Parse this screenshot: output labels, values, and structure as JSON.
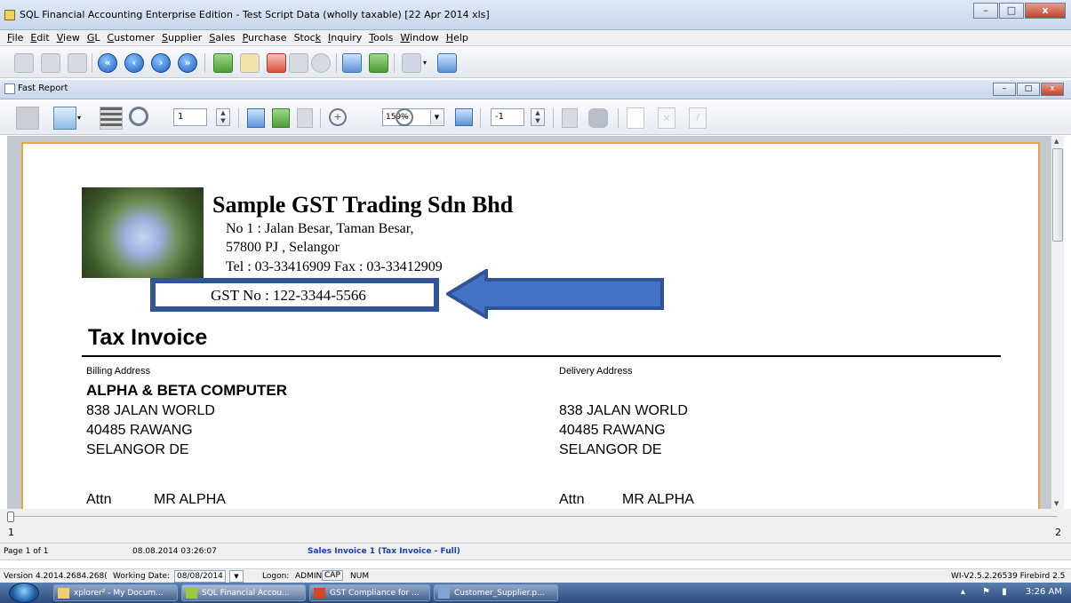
{
  "window": {
    "title": "SQL Financial Accounting Enterprise Edition - Test Script Data (wholly taxable) [22 Apr 2014 xls]"
  },
  "menu": [
    {
      "pre": "",
      "u": "F",
      "post": "ile"
    },
    {
      "pre": "",
      "u": "E",
      "post": "dit"
    },
    {
      "pre": "",
      "u": "V",
      "post": "iew"
    },
    {
      "pre": "",
      "u": "G",
      "post": "L"
    },
    {
      "pre": "",
      "u": "C",
      "post": "ustomer"
    },
    {
      "pre": "",
      "u": "S",
      "post": "upplier"
    },
    {
      "pre": "",
      "u": "S",
      "post": "ales"
    },
    {
      "pre": "",
      "u": "P",
      "post": "urchase"
    },
    {
      "pre": "Stoc",
      "u": "k",
      "post": ""
    },
    {
      "pre": "",
      "u": "I",
      "post": "nquiry"
    },
    {
      "pre": "",
      "u": "T",
      "post": "ools"
    },
    {
      "pre": "",
      "u": "W",
      "post": "indow"
    },
    {
      "pre": "",
      "u": "H",
      "post": "elp"
    }
  ],
  "report": {
    "window_title": "Fast Report",
    "page_input": "1",
    "zoom": "159%",
    "find_input": "-1"
  },
  "invoice": {
    "company_name": "Sample GST Trading Sdn Bhd",
    "address1": "No 1 : Jalan Besar, Taman Besar,",
    "address2": "57800 PJ , Selangor",
    "phone": "Tel : 03-33416909  Fax : 03-33412909",
    "gst_no": "GST No : 122-3344-5566",
    "doc_title": "Tax Invoice",
    "billing_label": "Billing Address",
    "delivery_label": "Delivery Address",
    "customer_name": "ALPHA & BETA COMPUTER",
    "billing": {
      "line1": "838 JALAN WORLD",
      "line2": "40485 RAWANG",
      "line3": "SELANGOR DE",
      "attn_label": "Attn",
      "attn": "MR ALPHA"
    },
    "delivery": {
      "line1": "838 JALAN WORLD",
      "line2": "40485 RAWANG",
      "line3": "SELANGOR DE",
      "attn_label": "Attn",
      "attn": "MR ALPHA"
    }
  },
  "slider": {
    "min": "1",
    "max": "2"
  },
  "status": {
    "page": "Page 1 of 1",
    "datetime": "08.08.2014 03:26:07",
    "report_name": "Sales Invoice 1 (Tax Invoice - Full)"
  },
  "appstatus": {
    "version": "Version 4.2014.2684.268(",
    "working_date_label": "Working Date:",
    "working_date": "08/08/2014",
    "logon_label": "Logon:",
    "user": "ADMIN",
    "cap": "CAP",
    "num": "NUM",
    "right": "WI-V2.5.2.26539 Firebird 2.5"
  },
  "taskbar": {
    "items": [
      "xplorer² - My Docum...",
      "SQL Financial Accou...",
      "GST Compliance for ...",
      "Customer_Supplier.p..."
    ],
    "time": "3:26 AM"
  },
  "colors": {
    "highlight": "#2f5597",
    "frame": "#e5a93c",
    "status_blue": "#1a3fb5"
  }
}
